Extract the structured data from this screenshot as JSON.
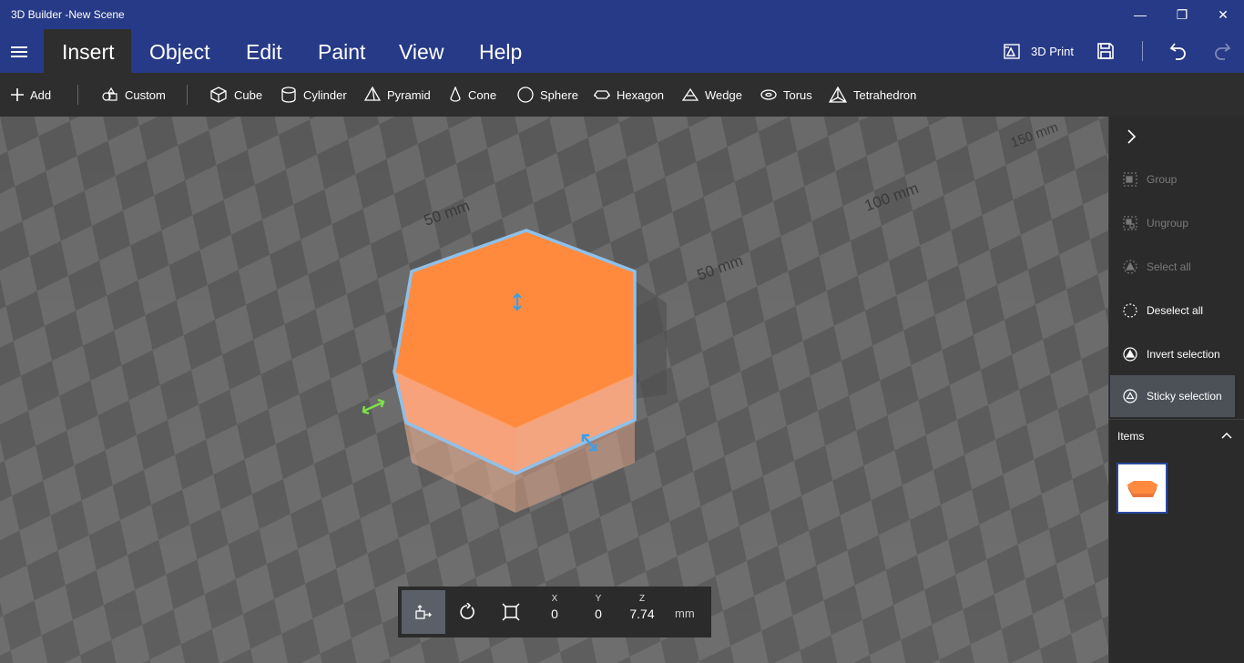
{
  "window": {
    "title": "3D Builder -New Scene",
    "minimize_glyph": "—",
    "restore_glyph": "❐",
    "close_glyph": "✕"
  },
  "menu": {
    "tabs": [
      {
        "label": "Insert",
        "active": true
      },
      {
        "label": "Object"
      },
      {
        "label": "Edit"
      },
      {
        "label": "Paint"
      },
      {
        "label": "View"
      },
      {
        "label": "Help"
      }
    ],
    "print_label": "3D Print",
    "icons": [
      "hamburger-icon",
      "3d-print-icon",
      "save-icon",
      "undo-icon",
      "redo-icon"
    ]
  },
  "toolbar": {
    "add": "Add",
    "custom": "Custom",
    "shapes": [
      "Cube",
      "Cylinder",
      "Pyramid",
      "Cone",
      "Sphere",
      "Hexagon",
      "Wedge",
      "Torus",
      "Tetrahedron"
    ]
  },
  "scene": {
    "floor_labels": [
      "50 mm",
      "50 mm",
      "100 mm",
      "150 mm"
    ],
    "object": "hexagon",
    "object_color": "#ff8840",
    "selection_color": "#8fc0ea"
  },
  "transform": {
    "x_label": "X",
    "x_value": "0",
    "y_label": "Y",
    "y_value": "0",
    "z_label": "Z",
    "z_value": "7.74",
    "unit": "mm"
  },
  "panel": {
    "items": [
      {
        "label": "Group",
        "enabled": false
      },
      {
        "label": "Ungroup",
        "enabled": false
      },
      {
        "label": "Select all",
        "enabled": false
      },
      {
        "label": "Deselect all",
        "enabled": true
      },
      {
        "label": "Invert selection",
        "enabled": true
      },
      {
        "label": "Sticky selection",
        "enabled": true,
        "selected": true
      }
    ],
    "items_header": "Items"
  },
  "colors": {
    "titlebar": "#273a87",
    "toolbar": "#2e2e2e",
    "panel": "#2b2b2b",
    "accent": "#8fc0ea"
  }
}
